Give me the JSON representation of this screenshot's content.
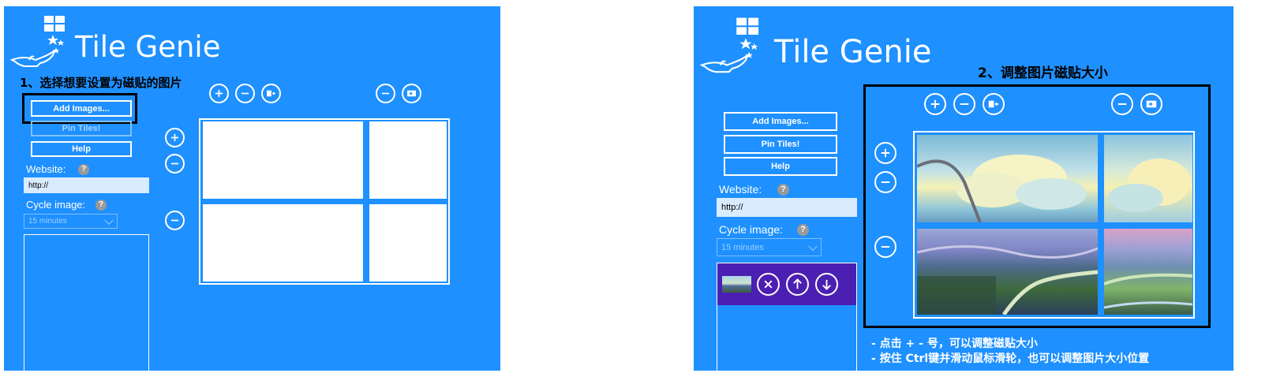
{
  "colors": {
    "panel_bg": "#1e90ff",
    "highlight_border": "#000000",
    "purple_row": "#4b1fb2"
  },
  "left": {
    "app_title": "Tile Genie",
    "step_label": "1、选择想要设置为磁贴的图片",
    "buttons": {
      "add_images": "Add Images...",
      "pin_tiles": "Pin Tiles!",
      "help": "Help"
    },
    "website_label": "Website:",
    "website_value": "http://",
    "cycle_label": "Cycle image:",
    "cycle_value": "15 minutes",
    "help_glyph": "?"
  },
  "right": {
    "app_title": "Tile Genie",
    "step_label": "2、调整图片磁贴大小",
    "buttons": {
      "add_images": "Add Images...",
      "pin_tiles": "Pin Tiles!",
      "help": "Help"
    },
    "website_label": "Website:",
    "website_value": "http://",
    "cycle_label": "Cycle image:",
    "cycle_value": "15 minutes",
    "help_glyph": "?",
    "note_line1": "- 点击 + - 号，可以调整磁贴大小",
    "note_line2": "- 按住 Ctrl键并滑动鼠标滑轮，也可以调整图片大小位置"
  },
  "icons": [
    "windows-logo-icon",
    "genie-lamp-icon",
    "plus-icon",
    "minus-icon",
    "move-left-icon",
    "move-right-icon",
    "remove-icon",
    "arrow-up-icon",
    "arrow-down-icon"
  ]
}
